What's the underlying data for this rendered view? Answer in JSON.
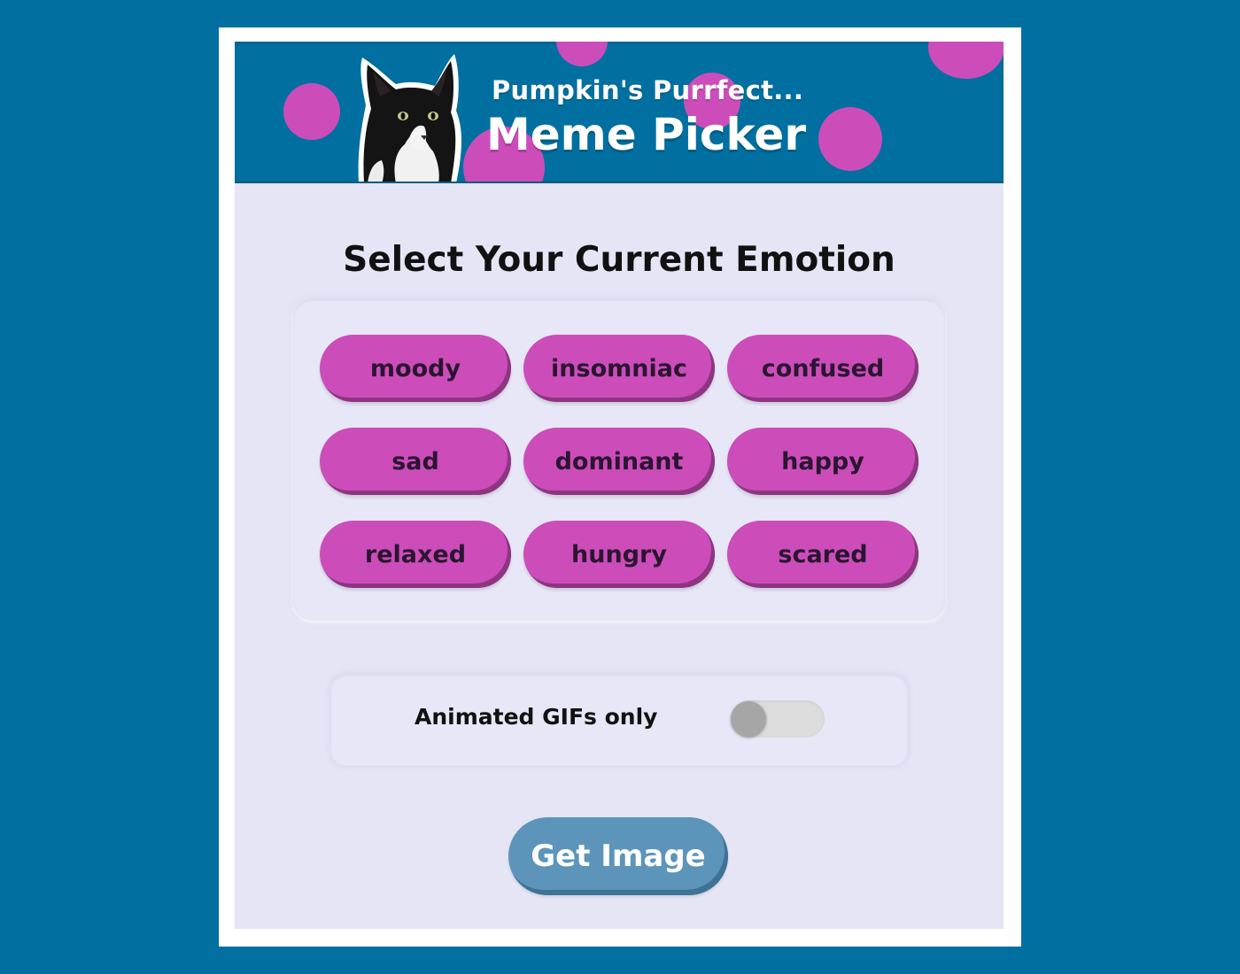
{
  "header": {
    "title_small": "Pumpkin's Purrfect...",
    "title_big": "Meme Picker",
    "image": "cat-photo"
  },
  "heading": "Select Your Current Emotion",
  "emotions": [
    "moody",
    "insomniac",
    "confused",
    "sad",
    "dominant",
    "happy",
    "relaxed",
    "hungry",
    "scared"
  ],
  "toggle": {
    "label": "Animated GIFs only",
    "checked": false
  },
  "action": {
    "label": "Get Image"
  },
  "colors": {
    "page_background": "#016fa0",
    "accent_pink": "#cc4dba",
    "panel_background": "#e6e5f6",
    "button_blue": "#5d95ba"
  }
}
